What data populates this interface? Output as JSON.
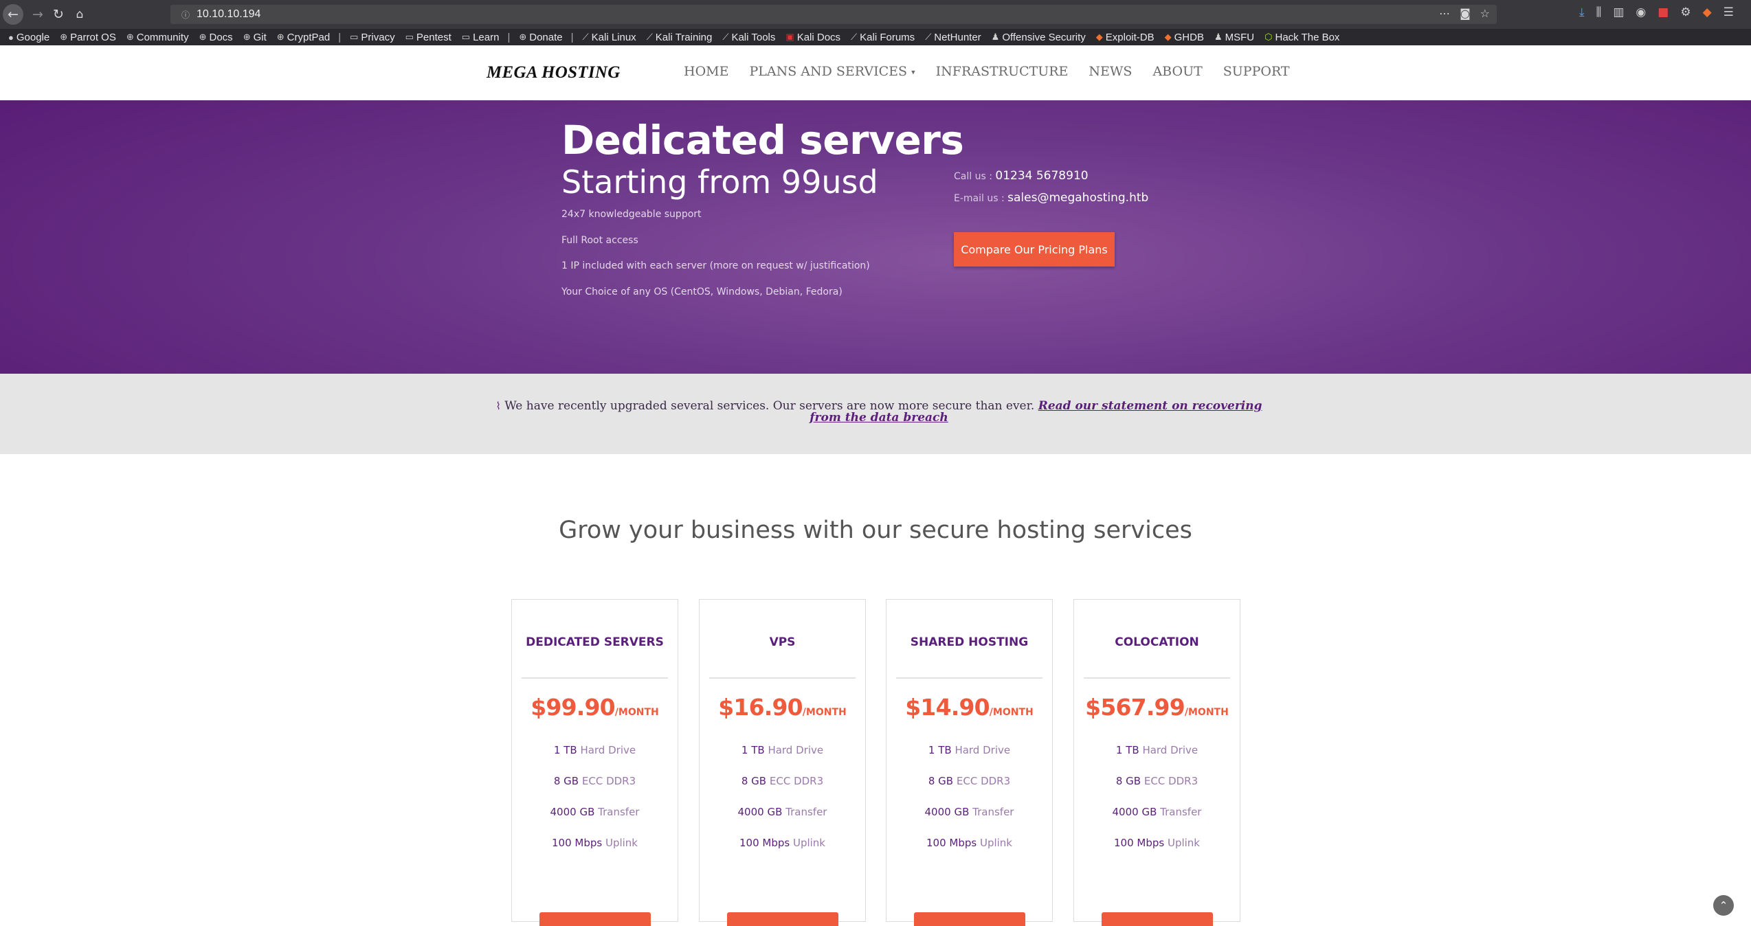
{
  "browser": {
    "url": "10.10.10.194",
    "bookmarks": [
      "Google",
      "Parrot OS",
      "Community",
      "Docs",
      "Git",
      "CryptPad",
      "Privacy",
      "Pentest",
      "Learn",
      "Donate",
      "Kali Linux",
      "Kali Training",
      "Kali Tools",
      "Kali Docs",
      "Kali Forums",
      "NetHunter",
      "Offensive Security",
      "Exploit-DB",
      "GHDB",
      "MSFU",
      "Hack The Box"
    ]
  },
  "site": {
    "logo": "MEGA HOSTING",
    "menu": [
      "HOME",
      "PLANS AND SERVICES",
      "INFRASTRUCTURE",
      "NEWS",
      "ABOUT",
      "SUPPORT"
    ]
  },
  "hero": {
    "title": "Dedicated servers",
    "subtitle": "Starting from 99usd",
    "features": [
      "24x7 knowledgeable support",
      "Full Root access",
      "1 IP included with each server (more on request w/ justification)",
      "Your Choice of any OS (CentOS, Windows, Debian, Fedora)"
    ],
    "call_label": "Call us :",
    "phone": "01234 5678910",
    "email_label": "E-mail us :",
    "email": "sales@megahosting.htb",
    "cta": "Compare Our Pricing Plans"
  },
  "notice": {
    "text": "We have recently upgraded several services. Our servers are now more secure than ever.",
    "link": "Read our statement on recovering from the data breach"
  },
  "plans_heading": "Grow your business with our secure hosting services",
  "plans": [
    {
      "name": "DEDICATED SERVERS",
      "price": "$99.90",
      "period": "/MONTH",
      "storage": "1 TB",
      "storage_label": "Hard Drive",
      "ram": "8 GB",
      "ram_label": "ECC DDR3",
      "transfer": "4000 GB",
      "transfer_label": "Transfer",
      "uplink": "100 Mbps",
      "uplink_label": "Uplink"
    },
    {
      "name": "VPS",
      "price": "$16.90",
      "period": "/MONTH",
      "storage": "1 TB",
      "storage_label": "Hard Drive",
      "ram": "8 GB",
      "ram_label": "ECC DDR3",
      "transfer": "4000 GB",
      "transfer_label": "Transfer",
      "uplink": "100 Mbps",
      "uplink_label": "Uplink"
    },
    {
      "name": "SHARED HOSTING",
      "price": "$14.90",
      "period": "/MONTH",
      "storage": "1 TB",
      "storage_label": "Hard Drive",
      "ram": "8 GB",
      "ram_label": "ECC DDR3",
      "transfer": "4000 GB",
      "transfer_label": "Transfer",
      "uplink": "100 Mbps",
      "uplink_label": "Uplink"
    },
    {
      "name": "COLOCATION",
      "price": "$567.99",
      "period": "/MONTH",
      "storage": "1 TB",
      "storage_label": "Hard Drive",
      "ram": "8 GB",
      "ram_label": "ECC DDR3",
      "transfer": "4000 GB",
      "transfer_label": "Transfer",
      "uplink": "100 Mbps",
      "uplink_label": "Uplink"
    }
  ],
  "colors": {
    "brand_purple": "#5a1f7a",
    "accent_orange": "#f05a3c"
  }
}
